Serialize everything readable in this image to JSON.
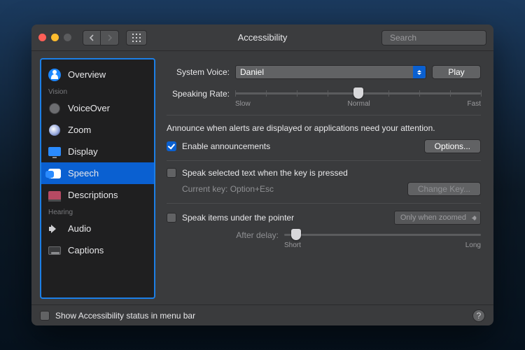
{
  "window": {
    "title": "Accessibility"
  },
  "search": {
    "placeholder": "Search"
  },
  "sidebar": {
    "overview": "Overview",
    "heading_vision": "Vision",
    "voiceover": "VoiceOver",
    "zoom": "Zoom",
    "display": "Display",
    "speech": "Speech",
    "descriptions": "Descriptions",
    "heading_hearing": "Hearing",
    "audio": "Audio",
    "captions": "Captions",
    "selected": "speech"
  },
  "main": {
    "system_voice_label": "System Voice:",
    "system_voice_value": "Daniel",
    "play_button": "Play",
    "speaking_rate_label": "Speaking Rate:",
    "rate_ticks": {
      "slow": "Slow",
      "normal": "Normal",
      "fast": "Fast"
    },
    "rate_value_pct": 50,
    "announce_desc": "Announce when alerts are displayed or applications need your attention.",
    "enable_announce_label": "Enable announcements",
    "enable_announce_checked": true,
    "options_button": "Options...",
    "speak_selected_label": "Speak selected text when the key is pressed",
    "speak_selected_checked": false,
    "current_key_label": "Current key: Option+Esc",
    "change_key_button": "Change Key...",
    "speak_pointer_label": "Speak items under the pointer",
    "speak_pointer_checked": false,
    "pointer_mode_value": "Only when zoomed",
    "after_delay_label": "After delay:",
    "delay_ticks": {
      "short": "Short",
      "long": "Long"
    },
    "delay_value_pct": 6
  },
  "footer": {
    "menubar_label": "Show Accessibility status in menu bar",
    "menubar_checked": false
  }
}
